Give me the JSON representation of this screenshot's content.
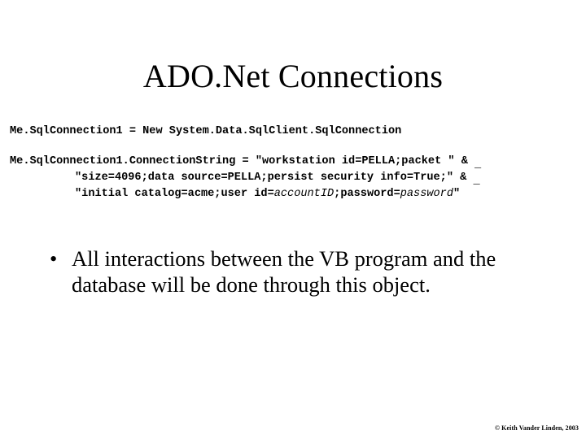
{
  "slide": {
    "title": "ADO.Net Connections",
    "code": {
      "lines": [
        {
          "type": "code",
          "indent": false,
          "segments": [
            {
              "text": "Me.SqlConnection1 = New System.Data.SqlClient.SqlConnection",
              "style": "bold"
            }
          ]
        },
        {
          "type": "blank",
          "indent": false,
          "segments": []
        },
        {
          "type": "code",
          "indent": false,
          "segments": [
            {
              "text": "Me.SqlConnection1.ConnectionString = \"workstation id=PELLA;packet \" & ",
              "style": "bold"
            },
            {
              "text": "_",
              "style": "continuation"
            }
          ]
        },
        {
          "type": "code",
          "indent": true,
          "segments": [
            {
              "text": "\"size=4096;data source=PELLA;persist security info=True;\" & ",
              "style": "bold"
            },
            {
              "text": "_",
              "style": "continuation"
            }
          ]
        },
        {
          "type": "code",
          "indent": true,
          "segments": [
            {
              "text": "\"initial catalog=acme;user id=",
              "style": "bold"
            },
            {
              "text": "accountID",
              "style": "italic"
            },
            {
              "text": ";password=",
              "style": "bold"
            },
            {
              "text": "password",
              "style": "italic"
            },
            {
              "text": "\"",
              "style": "bold"
            }
          ]
        }
      ]
    },
    "bullets": [
      {
        "marker": "•",
        "text": "All interactions between the VB program and the database will be done through this object."
      }
    ],
    "footer": "© Keith Vander Linden, 2003"
  },
  "colors": {
    "background": "#ffffff",
    "text": "#000000"
  }
}
